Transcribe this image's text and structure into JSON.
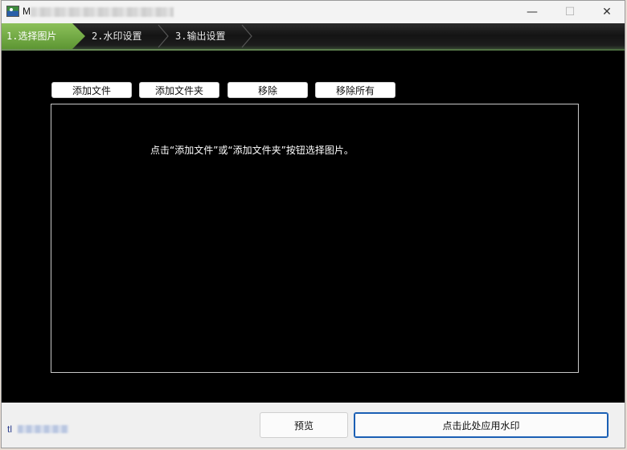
{
  "window": {
    "title": "M",
    "controls": {
      "minimize": "—",
      "maximize": "☐",
      "close": "✕"
    }
  },
  "steps": [
    {
      "label": "1.选择图片",
      "active": true
    },
    {
      "label": "2.水印设置",
      "active": false
    },
    {
      "label": "3.输出设置",
      "active": false
    }
  ],
  "toolbar": {
    "add_file": "添加文件",
    "add_folder": "添加文件夹",
    "remove": "移除",
    "remove_all": "移除所有"
  },
  "file_list": {
    "hint": "点击“添加文件”或“添加文件夹”按钮选择图片。"
  },
  "bottom": {
    "status": "tl",
    "preview": "预览",
    "apply": "点击此处应用水印"
  },
  "colors": {
    "accent": "#1a5fb4",
    "step_active": "#6fa844",
    "background": "#000000"
  }
}
